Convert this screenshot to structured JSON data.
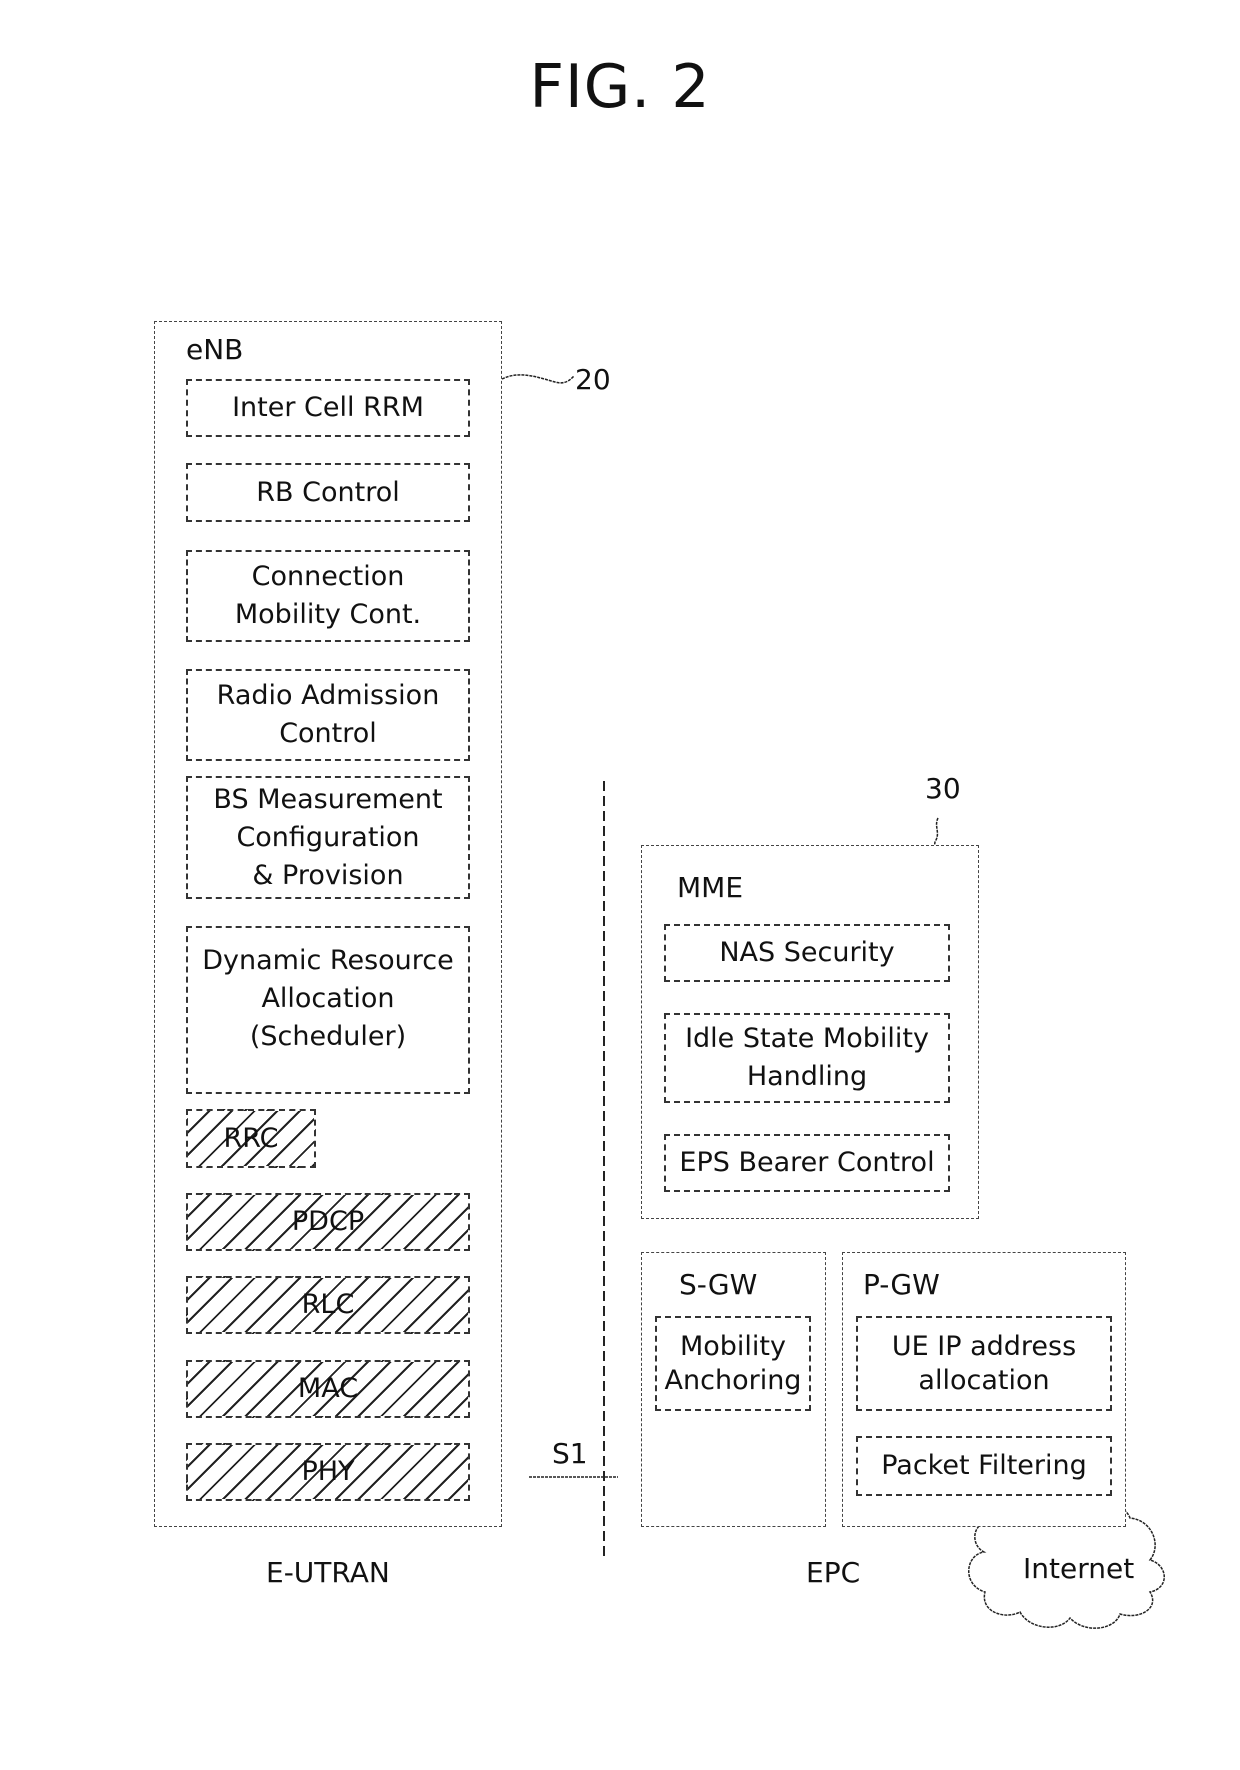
{
  "figure": {
    "title": "FIG. 2"
  },
  "enb": {
    "label": "eNB",
    "ref": "20",
    "functions": [
      "Inter Cell RRM",
      "RB Control",
      "Connection\nMobility Cont.",
      "Radio Admission\nControl",
      "BS Measurement\nConfiguration\n& Provision",
      "Dynamic Resource\nAllocation\n(Scheduler)"
    ],
    "layers": [
      "RRC",
      "PDCP",
      "RLC",
      "MAC",
      "PHY"
    ]
  },
  "interface": {
    "label": "S1"
  },
  "epc": {
    "ref": "30",
    "mme": {
      "label": "MME",
      "functions": [
        "NAS Security",
        "Idle State Mobility\nHandling",
        "EPS Bearer Control"
      ]
    },
    "sgw": {
      "label": "S-GW",
      "functions": [
        "Mobility\nAnchoring"
      ]
    },
    "pgw": {
      "label": "P-GW",
      "functions": [
        "UE IP address\nallocation",
        "Packet Filtering"
      ]
    }
  },
  "internet": {
    "label": "Internet"
  },
  "domains": {
    "left": "E-UTRAN",
    "right": "EPC"
  }
}
